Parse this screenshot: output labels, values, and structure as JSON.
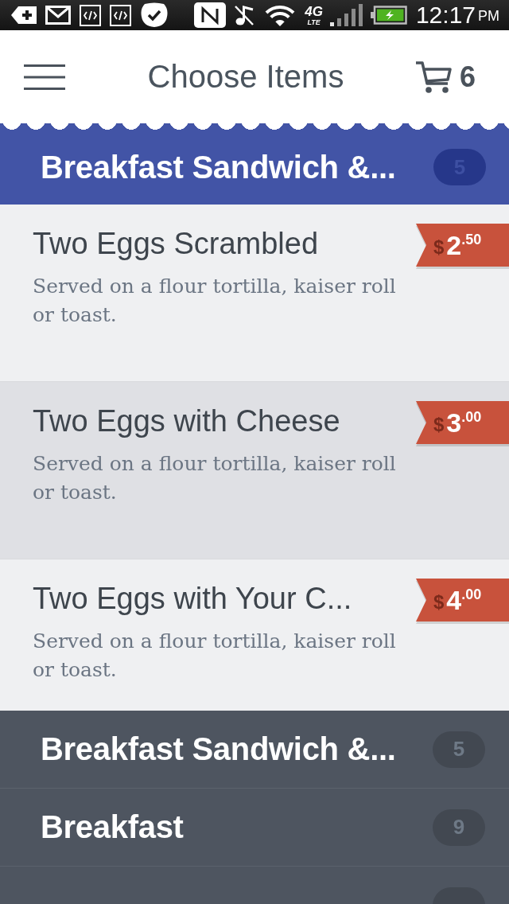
{
  "status_bar": {
    "network": "4G",
    "network_sub": "LTE",
    "time": "12:17",
    "meridiem": "PM"
  },
  "header": {
    "title": "Choose Items",
    "cart_count": "6"
  },
  "current_category": {
    "title": "Breakfast Sandwich &...",
    "count": "5"
  },
  "items": [
    {
      "name": "Two Eggs Scrambled",
      "description": "Served on a flour tortilla, kaiser roll or toast.",
      "price": {
        "currency": "$",
        "amount": "2$^{.50}$"
      },
      "selected": false
    },
    {
      "name": "Two Eggs with Cheese",
      "description": "Served on a flour tortilla, kaiser roll or toast.",
      "price": {
        "currency": "$",
        "amount": "3$^{.00}$"
      },
      "selected": true
    },
    {
      "name": "Two Eggs with Your C...",
      "description": "Served on a flour tortilla, kaiser roll or toast.",
      "price": {
        "currency": "$",
        "amount": "4$^{.00}$"
      },
      "selected": false
    }
  ],
  "categories": [
    {
      "title": "Breakfast Sandwich &...",
      "count": "5"
    },
    {
      "title": "Breakfast",
      "count": "9"
    }
  ]
}
